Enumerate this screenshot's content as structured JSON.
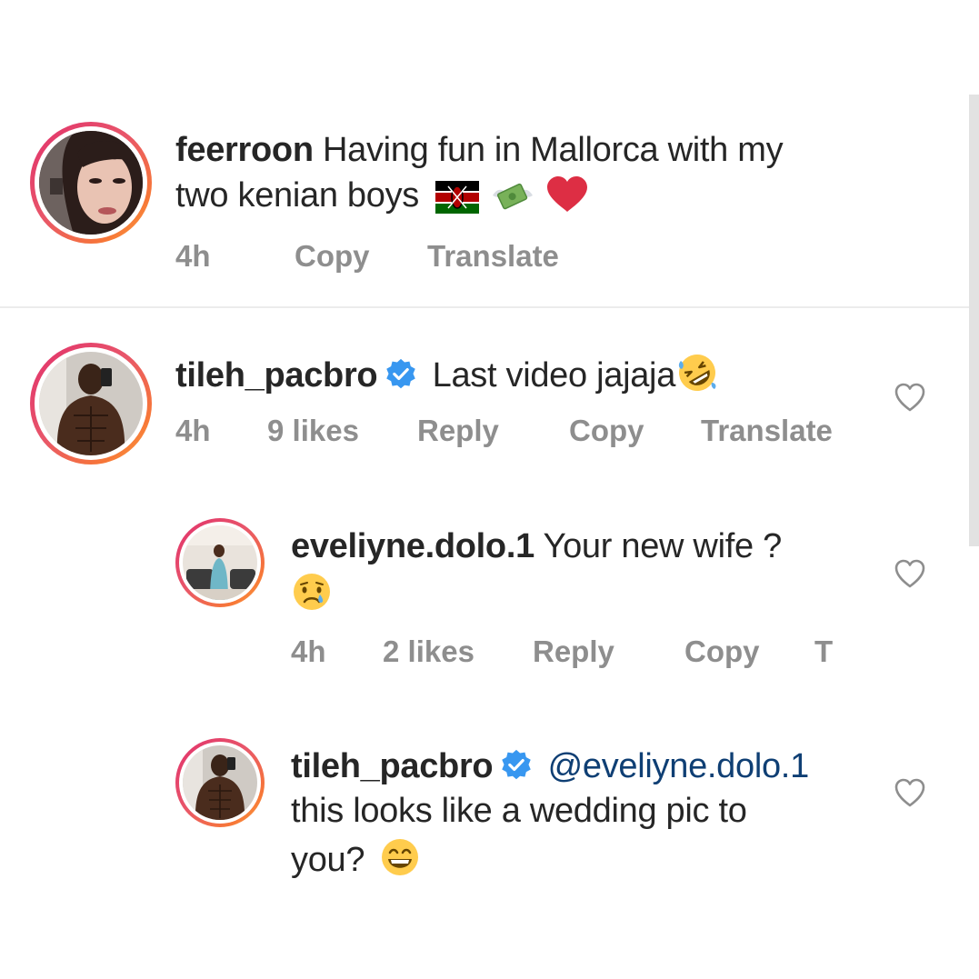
{
  "comments": [
    {
      "username": "feerroon",
      "text_line1": "Having fun in Mallorca with my",
      "text_line2": "two kenian boys",
      "time": "4h",
      "actions": {
        "copy": "Copy",
        "translate": "Translate"
      },
      "emojis": [
        "kenya-flag",
        "money-with-wings",
        "red-heart"
      ]
    },
    {
      "username": "tileh_pacbro",
      "verified": true,
      "text": "Last video jajaja",
      "time": "4h",
      "likes": "9 likes",
      "actions": {
        "reply": "Reply",
        "copy": "Copy",
        "translate": "Translate"
      },
      "emojis": [
        "rolling-on-floor-laughing"
      ]
    }
  ],
  "replies": [
    {
      "username": "eveliyne.dolo.1",
      "text": "Your new wife ?",
      "time": "4h",
      "likes": "2 likes",
      "actions": {
        "reply": "Reply",
        "copy": "Copy",
        "translate_truncated": "T"
      },
      "emojis": [
        "crying-face"
      ]
    },
    {
      "username": "tileh_pacbro",
      "verified": true,
      "mention": "@eveliyne.dolo.1",
      "text_line2": "this looks like a wedding pic to",
      "text_line3": "you?",
      "emojis": [
        "grinning-squinting-face"
      ]
    }
  ],
  "colors": {
    "text": "#262626",
    "meta": "#8e8e8e",
    "mention": "#0f3f74",
    "verified": "#3897f0",
    "story_ring_start": "#e1306c",
    "story_ring_end": "#fcaf45"
  }
}
